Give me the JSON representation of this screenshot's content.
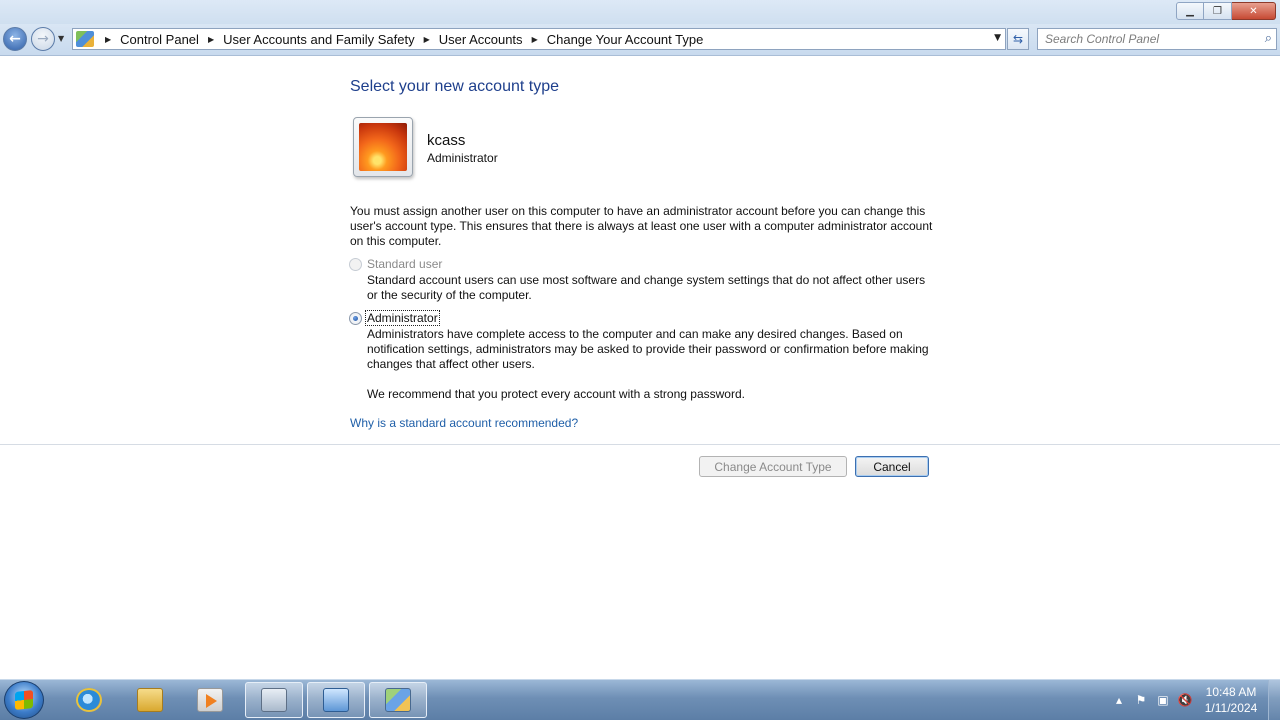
{
  "window": {
    "controls": {
      "minimize_icon": "minimize-icon",
      "maximize_icon": "restore-icon",
      "close_icon": "close-icon"
    }
  },
  "address_bar": {
    "breadcrumbs": [
      "Control Panel",
      "User Accounts and Family Safety",
      "User Accounts",
      "Change Your Account Type"
    ],
    "search_placeholder": "Search Control Panel"
  },
  "page": {
    "heading": "Select your new account type",
    "user": {
      "name": "kcass",
      "type": "Administrator"
    },
    "notice": "You must assign another user on this computer to have an administrator account before you can change this user's account type. This ensures that there is always at least one user with a computer administrator account on this computer.",
    "options": [
      {
        "label": "Standard user",
        "description": "Standard account users can use most software and change system settings that do not affect other users or the security of the computer.",
        "selected": false,
        "enabled": false
      },
      {
        "label": "Administrator",
        "description": "Administrators have complete access to the computer and can make any desired changes. Based on notification settings, administrators may be asked to provide their password or confirmation before making changes that affect other users.",
        "selected": true,
        "enabled": true
      }
    ],
    "recommendation": "We recommend that you protect every account with a strong password.",
    "help_link": "Why is a standard account recommended?",
    "buttons": {
      "change": "Change Account Type",
      "cancel": "Cancel"
    }
  },
  "taskbar": {
    "items": [
      "start-button",
      "internet-explorer",
      "windows-explorer",
      "media-player",
      "on-screen-keyboard",
      "remote-desktop",
      "control-panel"
    ],
    "clock": {
      "time": "10:48 AM",
      "date": "1/11/2024"
    }
  },
  "colors": {
    "heading": "#1e3f8c",
    "link": "#1f5fa8",
    "taskbar": "#6e8fb5"
  }
}
